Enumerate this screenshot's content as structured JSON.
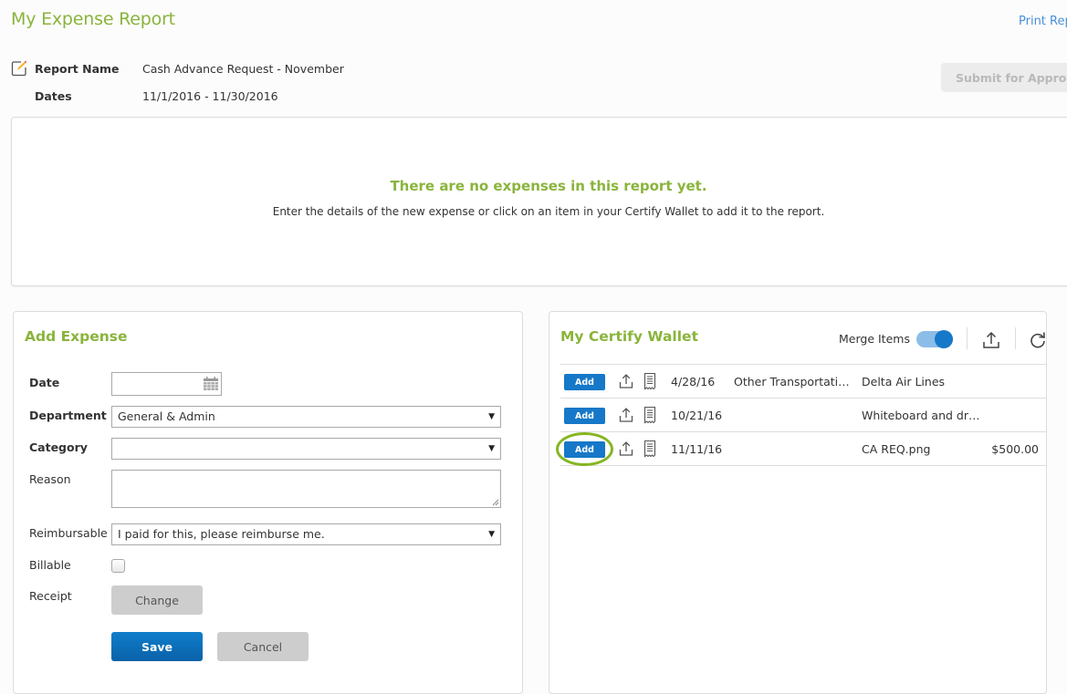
{
  "header": {
    "title": "My Expense Report",
    "print_link": "Print Report",
    "submit_button": "Submit for Approval"
  },
  "report": {
    "name_label": "Report Name",
    "name_value": "Cash Advance Request - November",
    "dates_label": "Dates",
    "dates_value": "11/1/2016 - 11/30/2016"
  },
  "empty_state": {
    "title": "There are no expenses in this report yet.",
    "description": "Enter the details of the new expense or click on an item in your Certify Wallet to add it to the report."
  },
  "add_expense": {
    "title": "Add Expense",
    "fields": {
      "date": {
        "label": "Date",
        "value": ""
      },
      "department": {
        "label": "Department",
        "value": "General & Admin"
      },
      "category": {
        "label": "Category",
        "value": ""
      },
      "reason": {
        "label": "Reason",
        "value": ""
      },
      "reimbursable": {
        "label": "Reimbursable",
        "value": "I paid for this, please reimburse me."
      },
      "billable": {
        "label": "Billable",
        "checked": false
      },
      "receipt": {
        "label": "Receipt"
      }
    },
    "buttons": {
      "change": "Change",
      "save": "Save",
      "cancel": "Cancel"
    }
  },
  "wallet": {
    "title": "My Certify Wallet",
    "merge_label": "Merge Items",
    "merge_enabled": true,
    "add_label": "Add",
    "items": [
      {
        "date": "4/28/16",
        "category": "Other Transportation",
        "merchant": "Delta Air Lines",
        "amount": "",
        "highlighted": false
      },
      {
        "date": "10/21/16",
        "category": "",
        "merchant": "Whiteboard and dry erase markers",
        "amount": "",
        "highlighted": false
      },
      {
        "date": "11/11/16",
        "category": "",
        "merchant": "CA REQ.png",
        "amount": "$500.00",
        "highlighted": true
      }
    ]
  },
  "colors": {
    "accent_green": "#8ab43c",
    "primary_blue": "#1678c8",
    "link_blue": "#4a8fd8",
    "highlight_ring": "#86b622"
  }
}
